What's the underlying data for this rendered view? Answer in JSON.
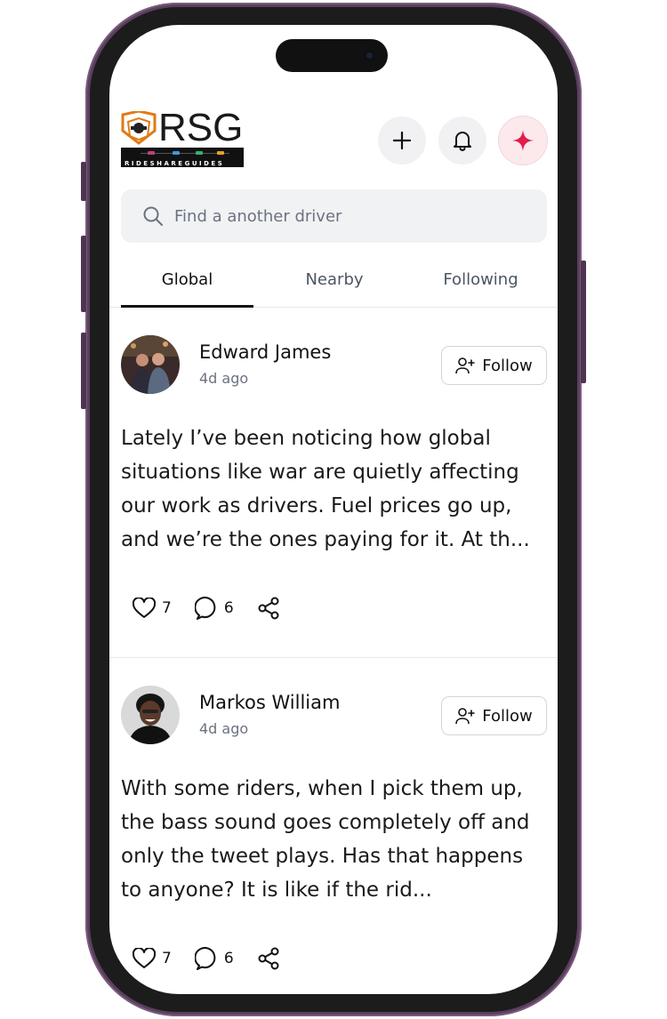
{
  "brand": {
    "logo_text": "RSG",
    "logo_strip": "RIDESHAREGUIDES"
  },
  "header": {
    "add_icon": "plus-icon",
    "bell_icon": "bell-icon",
    "spark_icon": "sparkle-icon",
    "spark_color": "#e11d48"
  },
  "search": {
    "placeholder": "Find a another driver"
  },
  "tabs": [
    {
      "label": "Global",
      "active": true
    },
    {
      "label": "Nearby",
      "active": false
    },
    {
      "label": "Following",
      "active": false
    }
  ],
  "posts": [
    {
      "author": "Edward James",
      "time": "4d ago",
      "follow_label": "Follow",
      "text": "Lately I’ve been noticing how global situations like war are quietly affecting our work as drivers. Fuel prices go up, and we’re the ones paying for it. At th...",
      "likes": "7",
      "comments": "6"
    },
    {
      "author": "Markos William",
      "time": "4d ago",
      "follow_label": "Follow",
      "text": "With some riders, when I pick them up, the bass sound goes completely off and only the tweet plays. Has that happens to anyone? It is like if the rid...",
      "likes": "7",
      "comments": "6"
    }
  ]
}
